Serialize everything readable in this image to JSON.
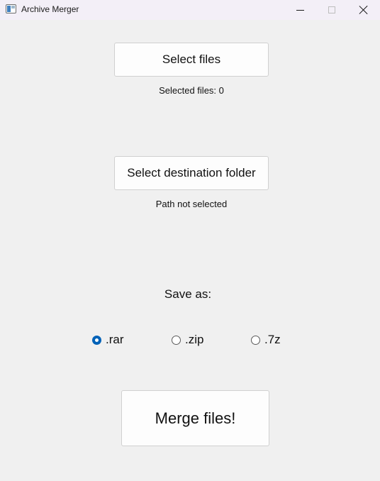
{
  "window": {
    "title": "Archive Merger"
  },
  "main": {
    "select_files_button": "Select files",
    "selected_files_text": "Selected files: 0",
    "select_destination_button": "Select destination folder",
    "path_text": "Path not selected",
    "save_as_label": "Save as:",
    "formats": [
      {
        "label": ".rar",
        "checked": true
      },
      {
        "label": ".zip",
        "checked": false
      },
      {
        "label": ".7z",
        "checked": false
      }
    ],
    "merge_button": "Merge files!"
  },
  "colors": {
    "background": "#f0f0f0",
    "titlebar": "#f3eff7",
    "accent": "#0062b8",
    "button": "#fdfdfd"
  },
  "icons": {
    "app": "app-window-icon",
    "minimize": "minimize-icon",
    "maximize": "maximize-icon",
    "close": "close-icon"
  }
}
